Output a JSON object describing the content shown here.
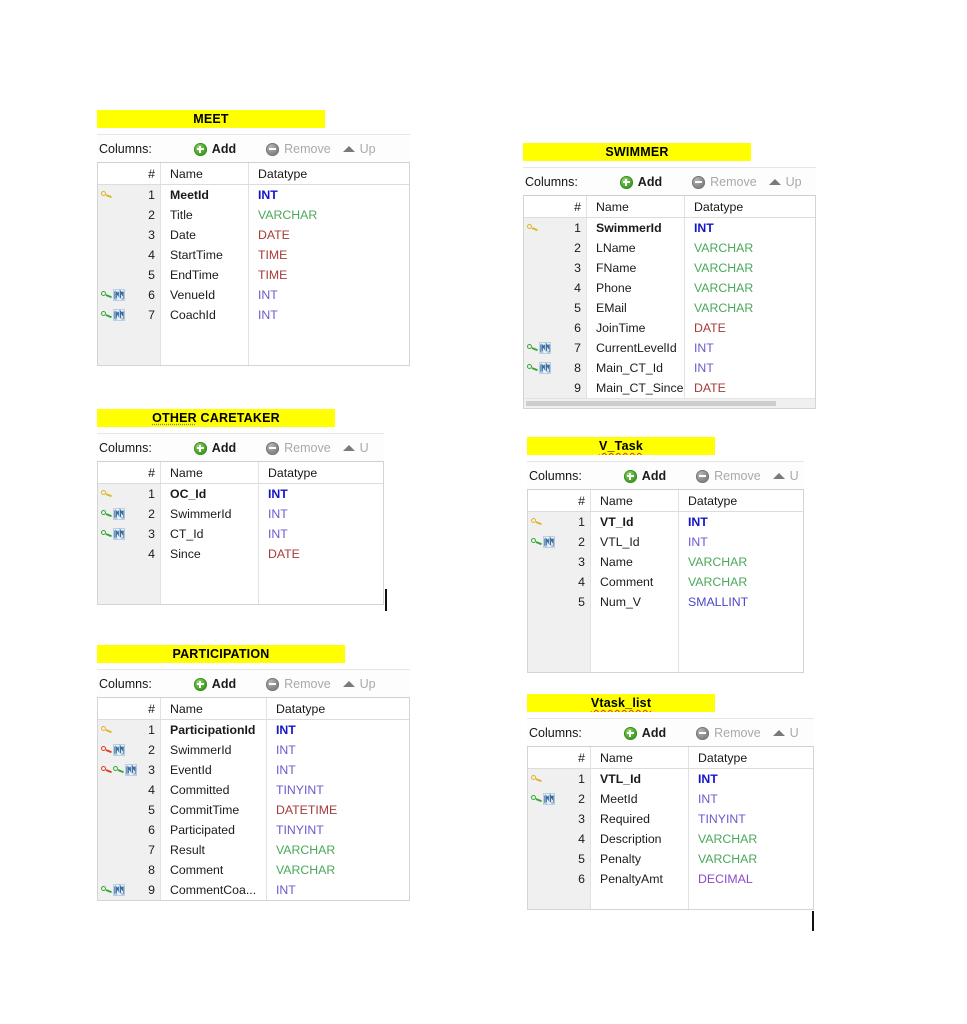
{
  "toolbar": {
    "columns_label": "Columns:",
    "add_label": "Add",
    "remove_label": "Remove",
    "up_label": "Up",
    "up_label_clipped": "U"
  },
  "grid_headers": {
    "num": "#",
    "name": "Name",
    "datatype": "Datatype"
  },
  "colors": {
    "highlight": "#ffff00",
    "int": "#6a5acd",
    "int_pk": "#1414c8",
    "varchar": "#4aa85a",
    "date": "#a63a3a",
    "time": "#a63a3a",
    "datetime": "#a63a3a",
    "tinyint": "#6a5acd",
    "smallint": "#4a46c8",
    "decimal": "#8a4ad0",
    "key_primary": "#e0b526",
    "key_foreign": "#35a832",
    "key_unique": "#e23c22",
    "add_button": "#49a72b"
  },
  "tables": [
    {
      "id": "meet",
      "title": "MEET",
      "title_spellcheck": "none",
      "columns": [
        {
          "num": "1",
          "name": "MeetId",
          "datatype": "INT",
          "type_class": "dt-int-pk",
          "pk": true,
          "icons": [
            "key-gold"
          ]
        },
        {
          "num": "2",
          "name": "Title",
          "datatype": "VARCHAR",
          "type_class": "dt-varchar",
          "pk": false,
          "icons": []
        },
        {
          "num": "3",
          "name": "Date",
          "datatype": "DATE",
          "type_class": "dt-date",
          "pk": false,
          "icons": []
        },
        {
          "num": "4",
          "name": "StartTime",
          "datatype": "TIME",
          "type_class": "dt-time",
          "pk": false,
          "icons": []
        },
        {
          "num": "5",
          "name": "EndTime",
          "datatype": "TIME",
          "type_class": "dt-time",
          "pk": false,
          "icons": []
        },
        {
          "num": "6",
          "name": "VenueId",
          "datatype": "INT",
          "type_class": "dt-int",
          "pk": false,
          "icons": [
            "key-green",
            "index"
          ]
        },
        {
          "num": "7",
          "name": "CoachId",
          "datatype": "INT",
          "type_class": "dt-int",
          "pk": false,
          "icons": [
            "key-green",
            "index"
          ]
        }
      ]
    },
    {
      "id": "swimmer",
      "title": "SWIMMER",
      "title_spellcheck": "none",
      "columns": [
        {
          "num": "1",
          "name": "SwimmerId",
          "datatype": "INT",
          "type_class": "dt-int-pk",
          "pk": true,
          "icons": [
            "key-gold"
          ]
        },
        {
          "num": "2",
          "name": "LName",
          "datatype": "VARCHAR",
          "type_class": "dt-varchar",
          "pk": false,
          "icons": []
        },
        {
          "num": "3",
          "name": "FName",
          "datatype": "VARCHAR",
          "type_class": "dt-varchar",
          "pk": false,
          "icons": []
        },
        {
          "num": "4",
          "name": "Phone",
          "datatype": "VARCHAR",
          "type_class": "dt-varchar",
          "pk": false,
          "icons": []
        },
        {
          "num": "5",
          "name": "EMail",
          "datatype": "VARCHAR",
          "type_class": "dt-varchar",
          "pk": false,
          "icons": []
        },
        {
          "num": "6",
          "name": "JoinTime",
          "datatype": "DATE",
          "type_class": "dt-date",
          "pk": false,
          "icons": []
        },
        {
          "num": "7",
          "name": "CurrentLevelId",
          "datatype": "INT",
          "type_class": "dt-int",
          "pk": false,
          "icons": [
            "key-green",
            "index"
          ]
        },
        {
          "num": "8",
          "name": "Main_CT_Id",
          "datatype": "INT",
          "type_class": "dt-int",
          "pk": false,
          "icons": [
            "key-green",
            "index"
          ]
        },
        {
          "num": "9",
          "name": "Main_CT_Since",
          "datatype": "DATE",
          "type_class": "dt-date",
          "pk": false,
          "icons": []
        }
      ]
    },
    {
      "id": "other-caretaker",
      "title_part1": "OTHER",
      "title_part2": " CARETAKER",
      "title": "OTHER CARETAKER",
      "title_spellcheck": "gray-part1",
      "columns": [
        {
          "num": "1",
          "name": "OC_Id",
          "datatype": "INT",
          "type_class": "dt-int-pk",
          "pk": true,
          "icons": [
            "key-gold"
          ]
        },
        {
          "num": "2",
          "name": "SwimmerId",
          "datatype": "INT",
          "type_class": "dt-int",
          "pk": false,
          "icons": [
            "key-green",
            "index"
          ]
        },
        {
          "num": "3",
          "name": "CT_Id",
          "datatype": "INT",
          "type_class": "dt-int",
          "pk": false,
          "icons": [
            "key-green",
            "index"
          ]
        },
        {
          "num": "4",
          "name": "Since",
          "datatype": "DATE",
          "type_class": "dt-date",
          "pk": false,
          "icons": []
        }
      ]
    },
    {
      "id": "v-task",
      "title": "V_Task",
      "title_spellcheck": "red",
      "columns": [
        {
          "num": "1",
          "name": "VT_Id",
          "datatype": "INT",
          "type_class": "dt-int-pk",
          "pk": true,
          "icons": [
            "key-gold"
          ]
        },
        {
          "num": "2",
          "name": "VTL_Id",
          "datatype": "INT",
          "type_class": "dt-int",
          "pk": false,
          "icons": [
            "key-green",
            "index"
          ]
        },
        {
          "num": "3",
          "name": "Name",
          "datatype": "VARCHAR",
          "type_class": "dt-varchar",
          "pk": false,
          "icons": []
        },
        {
          "num": "4",
          "name": "Comment",
          "datatype": "VARCHAR",
          "type_class": "dt-varchar",
          "pk": false,
          "icons": []
        },
        {
          "num": "5",
          "name": "Num_V",
          "datatype": "SMALLINT",
          "type_class": "dt-smallint",
          "pk": false,
          "icons": []
        }
      ]
    },
    {
      "id": "participation",
      "title": "PARTICIPATION",
      "title_spellcheck": "none",
      "columns": [
        {
          "num": "1",
          "name": "ParticipationId",
          "datatype": "INT",
          "type_class": "dt-int-pk",
          "pk": true,
          "icons": [
            "key-gold"
          ]
        },
        {
          "num": "2",
          "name": "SwimmerId",
          "datatype": "INT",
          "type_class": "dt-int",
          "pk": false,
          "icons": [
            "key-red",
            "index"
          ]
        },
        {
          "num": "3",
          "name": "EventId",
          "datatype": "INT",
          "type_class": "dt-int",
          "pk": false,
          "icons": [
            "key-red",
            "key-green",
            "index"
          ]
        },
        {
          "num": "4",
          "name": "Committed",
          "datatype": "TINYINT",
          "type_class": "dt-tinyint",
          "pk": false,
          "icons": []
        },
        {
          "num": "5",
          "name": "CommitTime",
          "datatype": "DATETIME",
          "type_class": "dt-datetime",
          "pk": false,
          "icons": []
        },
        {
          "num": "6",
          "name": "Participated",
          "datatype": "TINYINT",
          "type_class": "dt-tinyint",
          "pk": false,
          "icons": []
        },
        {
          "num": "7",
          "name": "Result",
          "datatype": "VARCHAR",
          "type_class": "dt-varchar",
          "pk": false,
          "icons": []
        },
        {
          "num": "8",
          "name": "Comment",
          "datatype": "VARCHAR",
          "type_class": "dt-varchar",
          "pk": false,
          "icons": []
        },
        {
          "num": "9",
          "name": "CommentCoa...",
          "datatype": "INT",
          "type_class": "dt-int",
          "pk": false,
          "icons": [
            "key-green",
            "index"
          ]
        }
      ]
    },
    {
      "id": "vtask-list",
      "title": "Vtask_list",
      "title_spellcheck": "red",
      "columns": [
        {
          "num": "1",
          "name": "VTL_Id",
          "datatype": "INT",
          "type_class": "dt-int-pk",
          "pk": true,
          "icons": [
            "key-gold"
          ]
        },
        {
          "num": "2",
          "name": "MeetId",
          "datatype": "INT",
          "type_class": "dt-int",
          "pk": false,
          "icons": [
            "key-green",
            "index"
          ]
        },
        {
          "num": "3",
          "name": "Required",
          "datatype": "TINYINT",
          "type_class": "dt-tinyint",
          "pk": false,
          "icons": []
        },
        {
          "num": "4",
          "name": "Description",
          "datatype": "VARCHAR",
          "type_class": "dt-varchar",
          "pk": false,
          "icons": []
        },
        {
          "num": "5",
          "name": "Penalty",
          "datatype": "VARCHAR",
          "type_class": "dt-varchar",
          "pk": false,
          "icons": []
        },
        {
          "num": "6",
          "name": "PenaltyAmt",
          "datatype": "DECIMAL",
          "type_class": "dt-decimal",
          "pk": false,
          "icons": []
        }
      ]
    }
  ]
}
